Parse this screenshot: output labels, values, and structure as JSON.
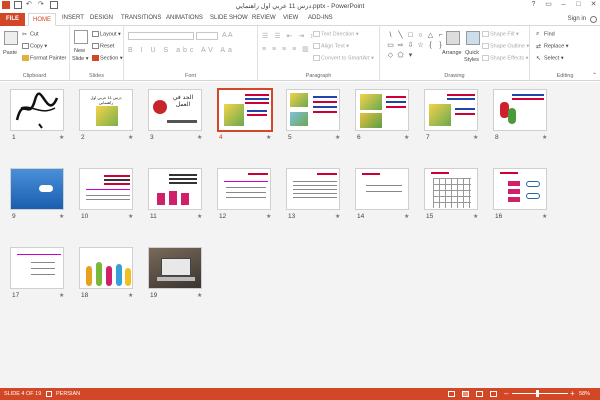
{
  "window": {
    "title": "ﺩﺭﺱ 11 ﻋﺮﺑﻲ ﺍﻭﻝ ﺭﺍﻫﻨﻤﺎﻳﻲ.pptx - PowerPoint",
    "sign_in": "Sign in"
  },
  "tabs": [
    {
      "label": "FILE"
    },
    {
      "label": "HOME"
    },
    {
      "label": "INSERT"
    },
    {
      "label": "DESIGN"
    },
    {
      "label": "TRANSITIONS"
    },
    {
      "label": "ANIMATIONS"
    },
    {
      "label": "SLIDE SHOW"
    },
    {
      "label": "REVIEW"
    },
    {
      "label": "VIEW"
    },
    {
      "label": "ADD-INS"
    }
  ],
  "ribbon": {
    "clipboard": {
      "paste": "Paste",
      "cut": "Cut",
      "copy": "Copy",
      "format_painter": "Format Painter",
      "label": "Clipboard"
    },
    "slides": {
      "new_slide": "New",
      "new_slide2": "Slide",
      "layout": "Layout",
      "reset": "Reset",
      "section": "Section",
      "label": "Slides"
    },
    "font": {
      "label": "Font"
    },
    "paragraph": {
      "text_direction": "Text Direction",
      "align_text": "Align Text",
      "convert": "Convert to SmartArt",
      "label": "Paragraph"
    },
    "drawing": {
      "arrange": "Arrange",
      "quick_styles": "Quick",
      "quick_styles2": "Styles",
      "shape_fill": "Shape Fill",
      "shape_outline": "Shape Outline",
      "shape_effects": "Shape Effects",
      "label": "Drawing"
    },
    "editing": {
      "find": "Find",
      "replace": "Replace",
      "select": "Select",
      "label": "Editing"
    }
  },
  "slides": [
    {
      "num": "1",
      "kind": "calligraphy"
    },
    {
      "num": "2",
      "kind": "title",
      "text": "ﺩﺭﺱ 11 ﻋﺮﺑﻲ ﺍﻭﻝ ﺭﺍﻫﻨﻤﺎﻳﻲ"
    },
    {
      "num": "3",
      "kind": "apple",
      "text": "ﺍﻟﺠﺪ ﻓﻲ ﺍﻟﻌﻤﻞ"
    },
    {
      "num": "4",
      "kind": "farm",
      "selected": true
    },
    {
      "num": "5",
      "kind": "farm2"
    },
    {
      "num": "6",
      "kind": "farm3"
    },
    {
      "num": "7",
      "kind": "farm4"
    },
    {
      "num": "8",
      "kind": "flowers"
    },
    {
      "num": "9",
      "kind": "blue"
    },
    {
      "num": "10",
      "kind": "text"
    },
    {
      "num": "11",
      "kind": "bars"
    },
    {
      "num": "12",
      "kind": "text"
    },
    {
      "num": "13",
      "kind": "text"
    },
    {
      "num": "14",
      "kind": "text"
    },
    {
      "num": "15",
      "kind": "grid"
    },
    {
      "num": "16",
      "kind": "boxes"
    },
    {
      "num": "17",
      "kind": "text"
    },
    {
      "num": "18",
      "kind": "vases"
    },
    {
      "num": "19",
      "kind": "photo"
    }
  ],
  "status": {
    "slide_of": "SLIDE 4 OF 19",
    "language": "PERSIAN",
    "zoom": "58%"
  },
  "colors": {
    "accent": "#d24726"
  }
}
